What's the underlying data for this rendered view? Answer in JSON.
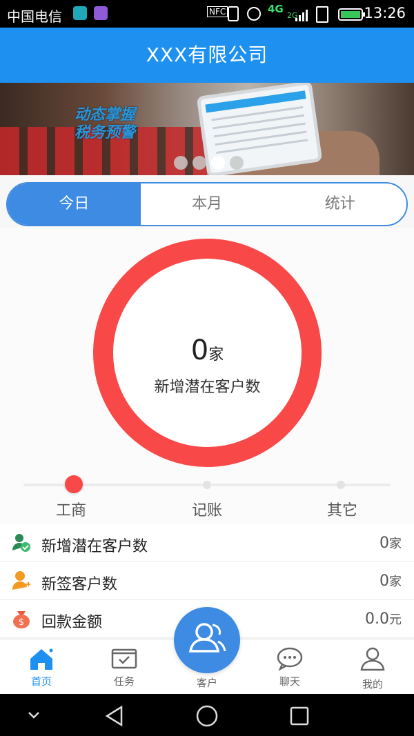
{
  "status_bar": {
    "carrier": "中国电信",
    "indicators": [
      "NFC",
      "4G",
      "2G"
    ],
    "time": "13:26"
  },
  "header": {
    "title": "XXX有限公司"
  },
  "banner": {
    "slogan_lines": [
      "动态掌握",
      "税务预警"
    ],
    "page_count": 4,
    "active_page": 3
  },
  "tabs": [
    {
      "label": "今日",
      "active": true
    },
    {
      "label": "本月",
      "active": false
    },
    {
      "label": "统计",
      "active": false
    }
  ],
  "ring": {
    "value": "0",
    "unit": "家",
    "label": "新增潜在客户数",
    "color": "#f84848"
  },
  "slider": {
    "options": [
      "工商",
      "记账",
      "其它"
    ],
    "selected": "工商"
  },
  "stats": [
    {
      "icon": "user-check-icon",
      "label": "新增潜在客户数",
      "value": "0",
      "unit": "家"
    },
    {
      "icon": "user-add-icon",
      "label": "新签客户数",
      "value": "0",
      "unit": "家"
    },
    {
      "icon": "money-bag-icon",
      "label": "回款金额",
      "value": "0.0",
      "unit": "元"
    }
  ],
  "bottom_nav": [
    {
      "label": "首页",
      "icon": "home-icon",
      "active": true
    },
    {
      "label": "任务",
      "icon": "task-icon",
      "active": false
    },
    {
      "label": "客户",
      "icon": "customers-icon",
      "active": false
    },
    {
      "label": "聊天",
      "icon": "chat-icon",
      "active": false
    },
    {
      "label": "我的",
      "icon": "profile-icon",
      "active": false
    }
  ],
  "colors": {
    "primary": "#1e90f0",
    "accent_red": "#f84848"
  }
}
